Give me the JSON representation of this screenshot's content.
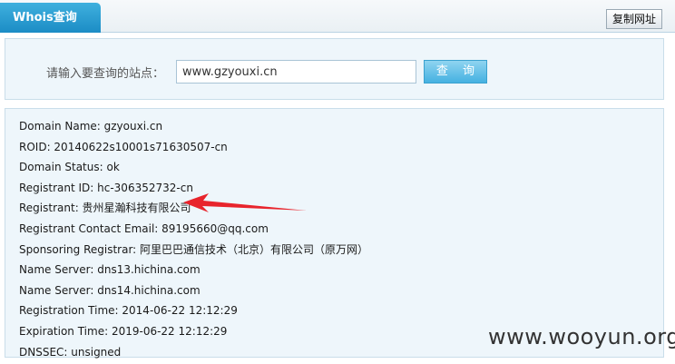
{
  "tabs": [
    {
      "label": "Whois查询"
    }
  ],
  "toolbar": {
    "copy_url_label": "复制网址"
  },
  "search": {
    "label": "请输入要查询的站点：",
    "value": "www.gzyouxi.cn",
    "button_label": "查 询"
  },
  "results": [
    "Domain Name: gzyouxi.cn",
    "ROID: 20140622s10001s71630507-cn",
    "Domain Status: ok",
    "Registrant ID: hc-306352732-cn",
    "Registrant: 贵州星瀚科技有限公司",
    "Registrant Contact Email: 89195660@qq.com",
    "Sponsoring Registrar: 阿里巴巴通信技术（北京）有限公司（原万网）",
    "Name Server: dns13.hichina.com",
    "Name Server: dns14.hichina.com",
    "Registration Time: 2014-06-22 12:12:29",
    "Expiration Time: 2019-06-22 12:12:29",
    "DNSSEC: unsigned"
  ],
  "annotation": {
    "arrow_color": "#e8242c",
    "arrow_icon": "red-arrow-icon"
  },
  "colors": {
    "tab": "#2a9fd6",
    "panel_bg": "#eef6fb",
    "button": "#5ebee6"
  },
  "watermark": "www.wooyun.org"
}
